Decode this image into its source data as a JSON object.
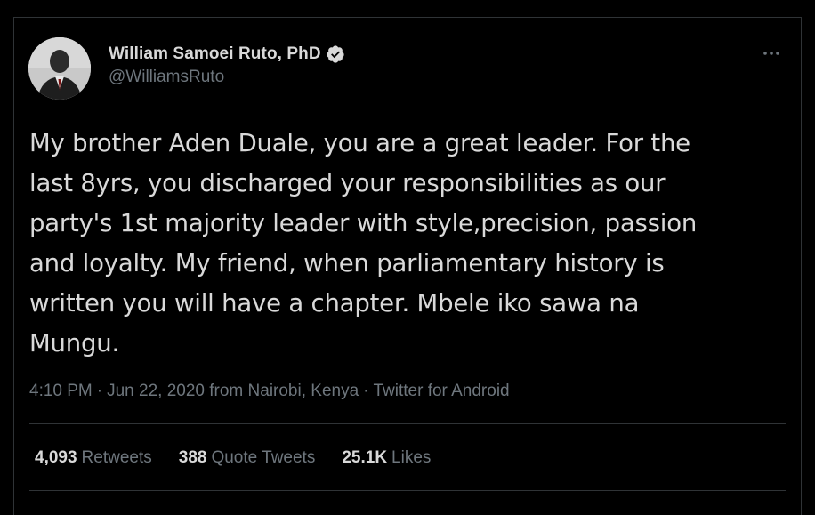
{
  "author": {
    "display_name": "William Samoei Ruto, PhD",
    "handle": "@WilliamsRuto",
    "verified": true
  },
  "tweet": {
    "text_lines": [
      "My brother Aden Duale, you are a great leader. For the",
      "last 8yrs, you discharged your responsibilities as our",
      "party's 1st majority leader with style,precision, passion",
      "and loyalty. My friend, when parliamentary history is",
      "written you will have a chapter. Mbele iko sawa na",
      "Mungu."
    ]
  },
  "meta": {
    "time": "4:10 PM",
    "date": "Jun 22, 2020",
    "location": "from Nairobi, Kenya",
    "source": "Twitter for Android",
    "separator": "·"
  },
  "stats": [
    {
      "count": "4,093",
      "label": "Retweets"
    },
    {
      "count": "388",
      "label": "Quote Tweets"
    },
    {
      "count": "25.1K",
      "label": "Likes"
    }
  ],
  "icons": {
    "verified": "verified-badge-icon",
    "more": "more-options-icon"
  },
  "colors": {
    "background": "#000000",
    "text": "#d9d9d9",
    "secondary": "#6e767d",
    "border": "#2f3336"
  }
}
